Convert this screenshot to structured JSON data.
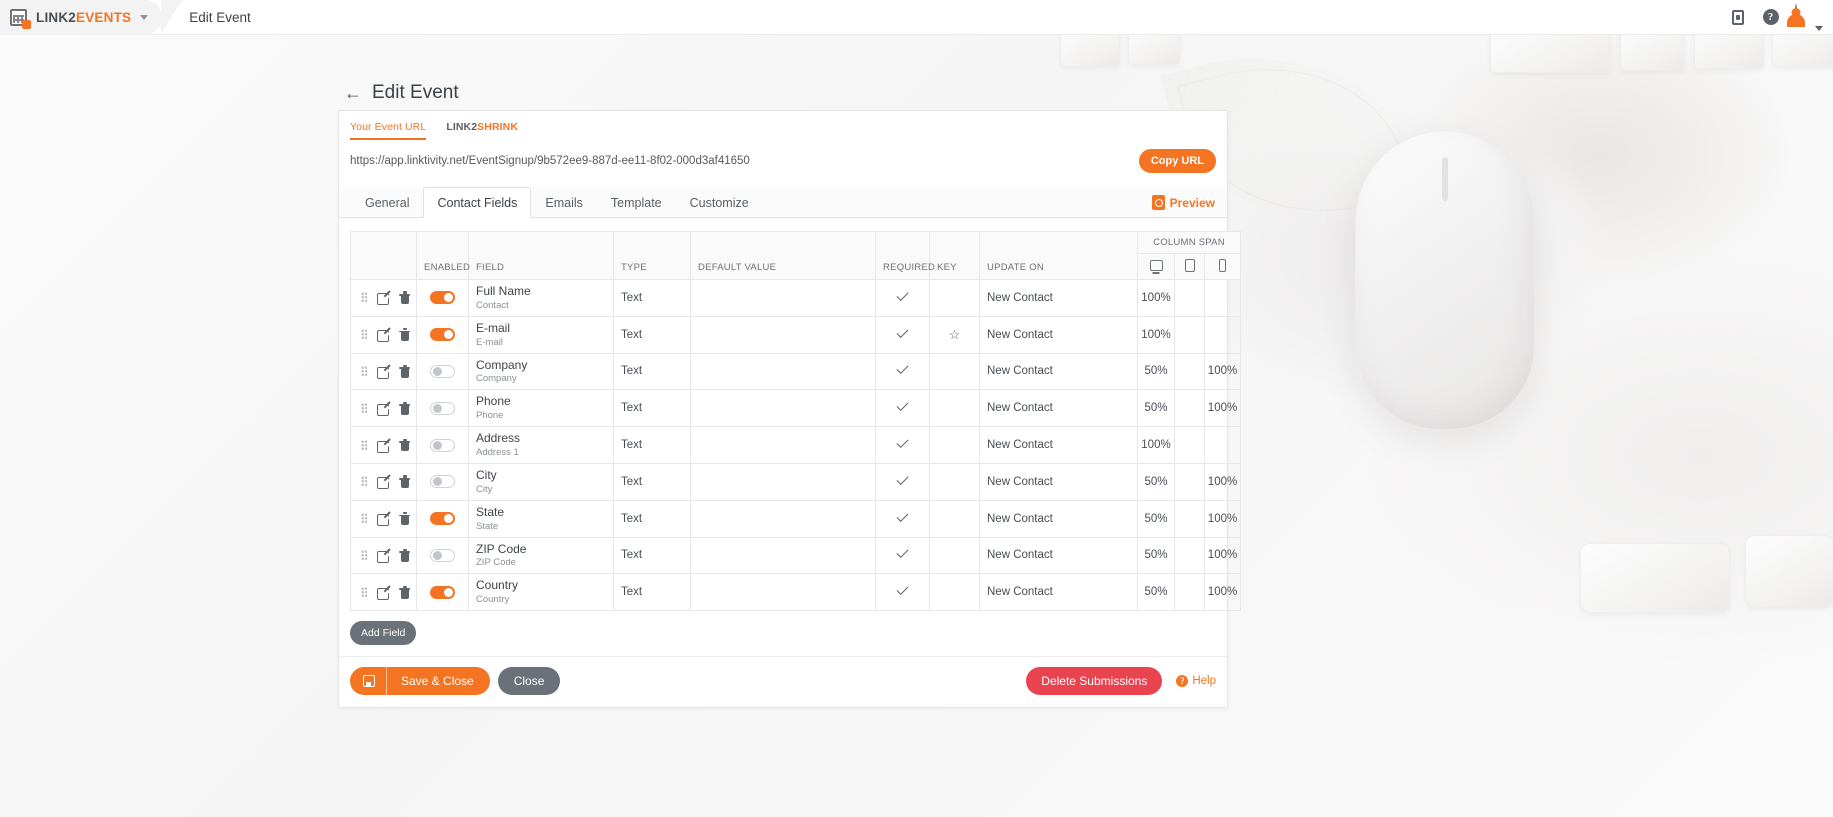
{
  "topbar": {
    "brand_prefix": "LINK2",
    "brand_accent": "EVENTS",
    "breadcrumb": "Edit Event",
    "calendar_icon": "calendar-icon",
    "caret_icon": "chevron-down-icon",
    "doc_icon": "document-icon",
    "help_icon": "help-icon",
    "help_glyph": "?",
    "avatar_icon": "user-avatar"
  },
  "page": {
    "back_arrow": "←",
    "title": "Edit Event"
  },
  "url_section": {
    "tabs": [
      {
        "label": "Your Event URL",
        "active": true
      },
      {
        "label_prefix": "LINK2",
        "label_accent": "SHRINK",
        "active": false
      }
    ],
    "url": "https://app.linktivity.net/EventSignup/9b572ee9-887d-ee11-8f02-000d3af41650",
    "copy_button": "Copy URL"
  },
  "main_tabs": {
    "items": [
      {
        "label": "General",
        "active": false
      },
      {
        "label": "Contact Fields",
        "active": true
      },
      {
        "label": "Emails",
        "active": false
      },
      {
        "label": "Template",
        "active": false
      },
      {
        "label": "Customize",
        "active": false
      }
    ],
    "preview_label": "Preview",
    "preview_icon": "preview-icon"
  },
  "table": {
    "headers": {
      "tools": "",
      "enabled": "ENABLED",
      "field": "FIELD",
      "type": "TYPE",
      "default_value": "DEFAULT VALUE",
      "required": "REQUIRED",
      "key": "KEY",
      "update_on": "UPDATE ON",
      "column_span": "COLUMN SPAN",
      "span_desktop_icon": "desktop-icon",
      "span_tablet_icon": "tablet-icon",
      "span_mobile_icon": "mobile-icon"
    },
    "rows": [
      {
        "enabled": true,
        "name": "Full Name",
        "sub": "Contact",
        "type": "Text",
        "default": "",
        "required": true,
        "key": false,
        "update_on": "New Contact",
        "span_desktop": "100%",
        "span_tablet": "",
        "span_mobile": ""
      },
      {
        "enabled": true,
        "name": "E-mail",
        "sub": "E-mail",
        "type": "Text",
        "default": "",
        "required": true,
        "key": true,
        "update_on": "New Contact",
        "span_desktop": "100%",
        "span_tablet": "",
        "span_mobile": ""
      },
      {
        "enabled": false,
        "name": "Company",
        "sub": "Company",
        "type": "Text",
        "default": "",
        "required": true,
        "key": false,
        "update_on": "New Contact",
        "span_desktop": "50%",
        "span_tablet": "",
        "span_mobile": "100%"
      },
      {
        "enabled": false,
        "name": "Phone",
        "sub": "Phone",
        "type": "Text",
        "default": "",
        "required": true,
        "key": false,
        "update_on": "New Contact",
        "span_desktop": "50%",
        "span_tablet": "",
        "span_mobile": "100%"
      },
      {
        "enabled": false,
        "name": "Address",
        "sub": "Address 1",
        "type": "Text",
        "default": "",
        "required": true,
        "key": false,
        "update_on": "New Contact",
        "span_desktop": "100%",
        "span_tablet": "",
        "span_mobile": ""
      },
      {
        "enabled": false,
        "name": "City",
        "sub": "City",
        "type": "Text",
        "default": "",
        "required": true,
        "key": false,
        "update_on": "New Contact",
        "span_desktop": "50%",
        "span_tablet": "",
        "span_mobile": "100%"
      },
      {
        "enabled": true,
        "name": "State",
        "sub": "State",
        "type": "Text",
        "default": "",
        "required": true,
        "key": false,
        "update_on": "New Contact",
        "span_desktop": "50%",
        "span_tablet": "",
        "span_mobile": "100%"
      },
      {
        "enabled": false,
        "name": "ZIP Code",
        "sub": "ZIP Code",
        "type": "Text",
        "default": "",
        "required": true,
        "key": false,
        "update_on": "New Contact",
        "span_desktop": "50%",
        "span_tablet": "",
        "span_mobile": "100%"
      },
      {
        "enabled": true,
        "name": "Country",
        "sub": "Country",
        "type": "Text",
        "default": "",
        "required": true,
        "key": false,
        "update_on": "New Contact",
        "span_desktop": "50%",
        "span_tablet": "",
        "span_mobile": "100%"
      }
    ],
    "row_icons": {
      "grip": "drag-handle-icon",
      "edit": "edit-icon",
      "delete": "trash-icon"
    }
  },
  "footer": {
    "add_field": "Add Field",
    "save_close": "Save & Close",
    "save_icon": "save-icon",
    "close": "Close",
    "delete_submissions": "Delete Submissions",
    "help": "Help",
    "help_icon": "help-circle-icon",
    "help_glyph": "?"
  },
  "colors": {
    "accent": "#f47421",
    "gray_button": "#6b7178",
    "danger": "#e8434f"
  }
}
